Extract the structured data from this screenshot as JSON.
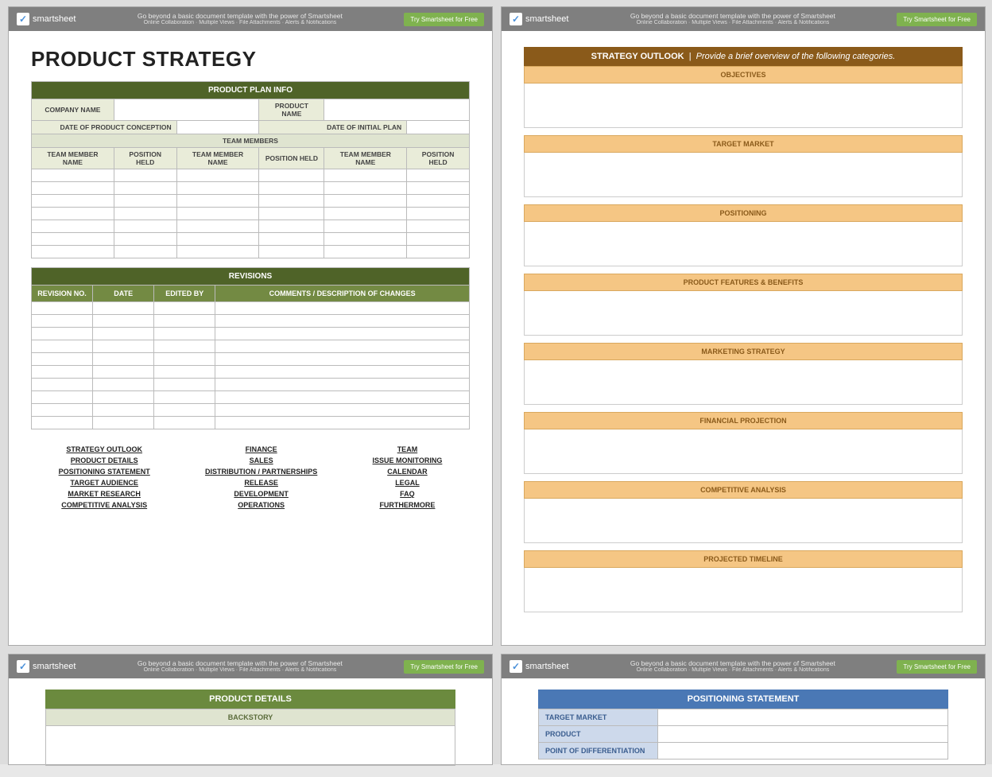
{
  "brand": {
    "name": "smartsheet",
    "check": "✓",
    "tagline1": "Go beyond a basic document template with the power of Smartsheet",
    "tagline2": "Online Collaboration · Multiple Views · File Attachments · Alerts & Notifications",
    "cta": "Try Smartsheet for Free"
  },
  "page1": {
    "title": "PRODUCT STRATEGY",
    "plan_info_header": "PRODUCT PLAN INFO",
    "labels": {
      "company_name": "COMPANY NAME",
      "product_name": "PRODUCT NAME",
      "date_conception": "DATE OF PRODUCT CONCEPTION",
      "date_initial_plan": "DATE OF INITIAL PLAN",
      "team_members": "TEAM MEMBERS",
      "team_member_name": "TEAM MEMBER NAME",
      "position_held": "POSITION HELD"
    },
    "revisions_header": "REVISIONS",
    "rev_cols": {
      "no": "REVISION NO.",
      "date": "DATE",
      "edited": "EDITED BY",
      "comments": "COMMENTS / DESCRIPTION OF CHANGES"
    },
    "links": {
      "col1": [
        "STRATEGY OUTLOOK",
        "PRODUCT DETAILS",
        "POSITIONING STATEMENT",
        "TARGET AUDIENCE",
        "MARKET RESEARCH",
        "COMPETITIVE ANALYSIS"
      ],
      "col2": [
        "FINANCE",
        "SALES",
        "DISTRIBUTION / PARTNERSHIPS",
        "RELEASE",
        "DEVELOPMENT",
        "OPERATIONS"
      ],
      "col3": [
        "TEAM",
        "ISSUE MONITORING",
        "CALENDAR",
        "LEGAL",
        "FAQ",
        "FURTHERMORE"
      ]
    }
  },
  "page2": {
    "header_label": "STRATEGY OUTLOOK",
    "header_sub": "Provide a brief overview of the following categories.",
    "categories": [
      "OBJECTIVES",
      "TARGET MARKET",
      "POSITIONING",
      "PRODUCT FEATURES & BENEFITS",
      "MARKETING STRATEGY",
      "FINANCIAL PROJECTION",
      "COMPETITIVE ANALYSIS",
      "PROJECTED TIMELINE"
    ]
  },
  "page3": {
    "header": "PRODUCT DETAILS",
    "sub": "BACKSTORY"
  },
  "page4": {
    "header": "POSITIONING STATEMENT",
    "rows": [
      "TARGET MARKET",
      "PRODUCT",
      "POINT OF DIFFERENTIATION"
    ]
  }
}
